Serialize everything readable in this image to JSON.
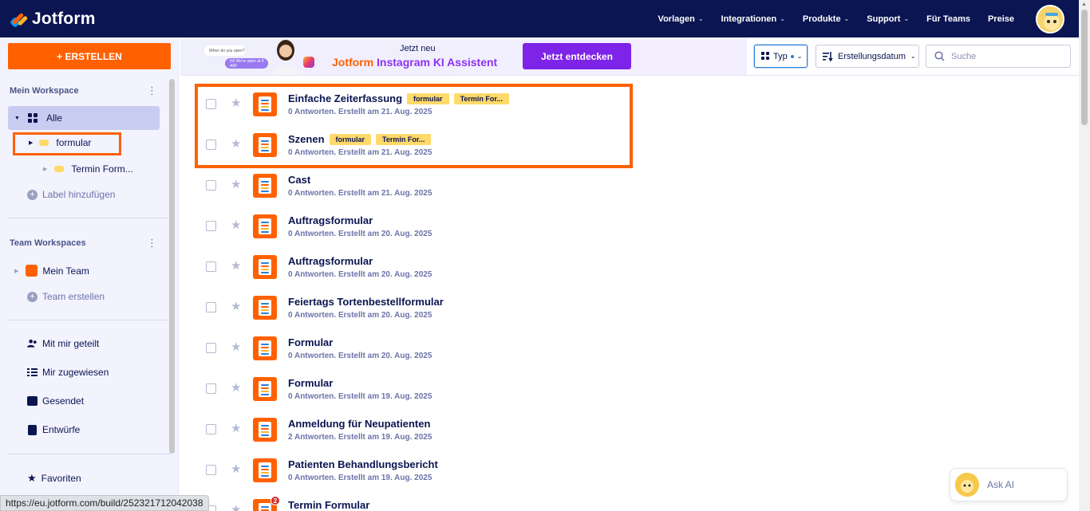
{
  "app": {
    "brand": "Jotform"
  },
  "nav": {
    "items": [
      {
        "label": "Vorlagen",
        "dropdown": true
      },
      {
        "label": "Integrationen",
        "dropdown": true
      },
      {
        "label": "Produkte",
        "dropdown": true
      },
      {
        "label": "Support",
        "dropdown": true
      },
      {
        "label": "Für Teams",
        "dropdown": false
      },
      {
        "label": "Preise",
        "dropdown": false
      }
    ]
  },
  "sidebar": {
    "create_label": "+ ERSTELLEN",
    "my_workspace": "Mein Workspace",
    "all_label": "Alle",
    "folders": [
      "formular",
      "Termin Form..."
    ],
    "add_label": "Label hinzufügen",
    "team_workspaces": "Team Workspaces",
    "my_team": "Mein Team",
    "create_team": "Team erstellen",
    "links": [
      "Mit mir geteilt",
      "Mir zugewiesen",
      "Gesendet",
      "Entwürfe"
    ],
    "favorites": "Favoriten"
  },
  "banner": {
    "small": "Jetzt neu",
    "title_orange": "Jotform",
    "title_purple": "Instagram KI Assistent",
    "button": "Jetzt entdecken",
    "chat1": "When do you open?",
    "chat2": "Hi! We're open at 9 AM!"
  },
  "toolbar": {
    "type_label": "Typ",
    "sort_label": "Erstellungsdatum",
    "search_placeholder": "Suche"
  },
  "forms": [
    {
      "name": "Einfache Zeiterfassung",
      "meta": "0 Antworten. Erstellt am 21. Aug. 2025",
      "tags": [
        "formular",
        "Termin For..."
      ]
    },
    {
      "name": "Szenen",
      "meta": "0 Antworten. Erstellt am 21. Aug. 2025",
      "tags": [
        "formular",
        "Termin For..."
      ]
    },
    {
      "name": "Cast",
      "meta": "0 Antworten. Erstellt am 21. Aug. 2025",
      "tags": []
    },
    {
      "name": "Auftragsformular",
      "meta": "0 Antworten. Erstellt am 20. Aug. 2025",
      "tags": []
    },
    {
      "name": "Auftragsformular",
      "meta": "0 Antworten. Erstellt am 20. Aug. 2025",
      "tags": []
    },
    {
      "name": "Feiertags Tortenbestellformular",
      "meta": "0 Antworten. Erstellt am 20. Aug. 2025",
      "tags": []
    },
    {
      "name": "Formular",
      "meta": "0 Antworten. Erstellt am 20. Aug. 2025",
      "tags": []
    },
    {
      "name": "Formular",
      "meta": "0 Antworten. Erstellt am 19. Aug. 2025",
      "tags": []
    },
    {
      "name": "Anmeldung für Neupatienten",
      "meta": "2 Antworten. Erstellt am 19. Aug. 2025",
      "tags": []
    },
    {
      "name": "Patienten Behandlungsbericht",
      "meta": "0 Antworten. Erstellt am 19. Aug. 2025",
      "tags": []
    },
    {
      "name": "Termin Formular",
      "meta": "",
      "tags": [],
      "badge": "2"
    }
  ],
  "ask_ai": "Ask AI",
  "status_url": "https://eu.jotform.com/build/252321712042038",
  "colors": {
    "nav_bg": "#0a1551",
    "accent": "#ff6100",
    "purple": "#7e23e8",
    "tag": "#ffd96a"
  }
}
